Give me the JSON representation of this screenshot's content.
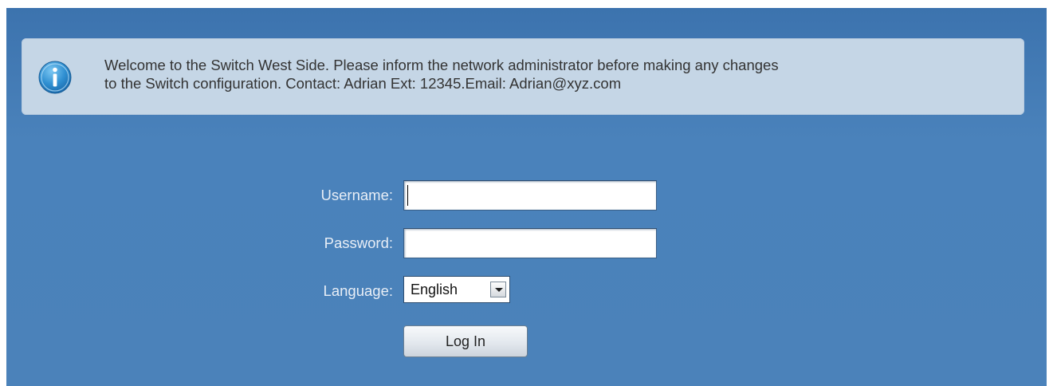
{
  "banner": {
    "icon": "info-icon",
    "message_line1": "Welcome to the Switch West Side. Please inform the network administrator before making any changes",
    "message_line2": "to the Switch configuration. Contact: Adrian Ext: 12345.Email: Adrian@xyz.com"
  },
  "login_form": {
    "username_label": "Username:",
    "username_value": "",
    "password_label": "Password:",
    "password_value": "",
    "language_label": "Language:",
    "language_selected": "English",
    "login_button": "Log In"
  },
  "colors": {
    "panel_background": "#4a82bb",
    "banner_background": "#c5d6e6",
    "info_icon": "#2f8fd1"
  }
}
